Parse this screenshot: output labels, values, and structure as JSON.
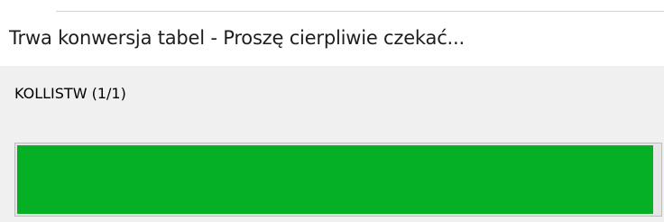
{
  "dialog": {
    "title": "Trwa konwersja tabel - Proszę cierpliwie czekać...",
    "status_label": "KOLLISTW (1/1)",
    "progress": {
      "fraction": 0.99,
      "fill_color": "#06b025"
    }
  }
}
